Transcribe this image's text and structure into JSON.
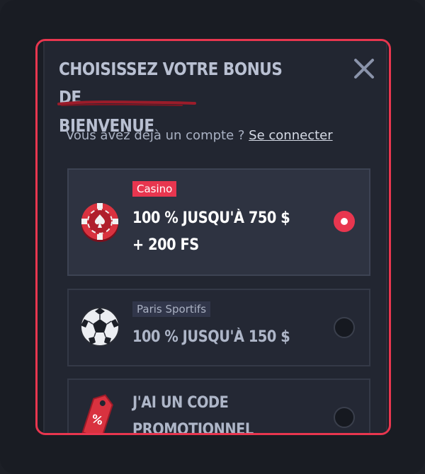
{
  "modal": {
    "title_line1": "CHOISISSEZ VOTRE BONUS DE",
    "title_line2": "BIENVENUE",
    "close_icon": "close-icon",
    "login_prompt": "Vous avez déjà un compte ?",
    "login_link": "Se connecter"
  },
  "options": [
    {
      "tag": "Casino",
      "line1": "100 % JUSQU'À 750 $",
      "line2": "+ 200 FS",
      "icon": "casino-chip-icon",
      "selected": true
    },
    {
      "tag": "Paris Sportifs",
      "line1": "100 % JUSQU'À 150 $",
      "icon": "soccer-ball-icon",
      "selected": false
    },
    {
      "line1": "J'AI UN CODE",
      "line2": "PROMOTIONNEL",
      "icon": "promo-tag-icon",
      "selected": false
    }
  ],
  "colors": {
    "accent": "#e8364f",
    "background": "#222631",
    "text_muted": "#aab2c4"
  }
}
